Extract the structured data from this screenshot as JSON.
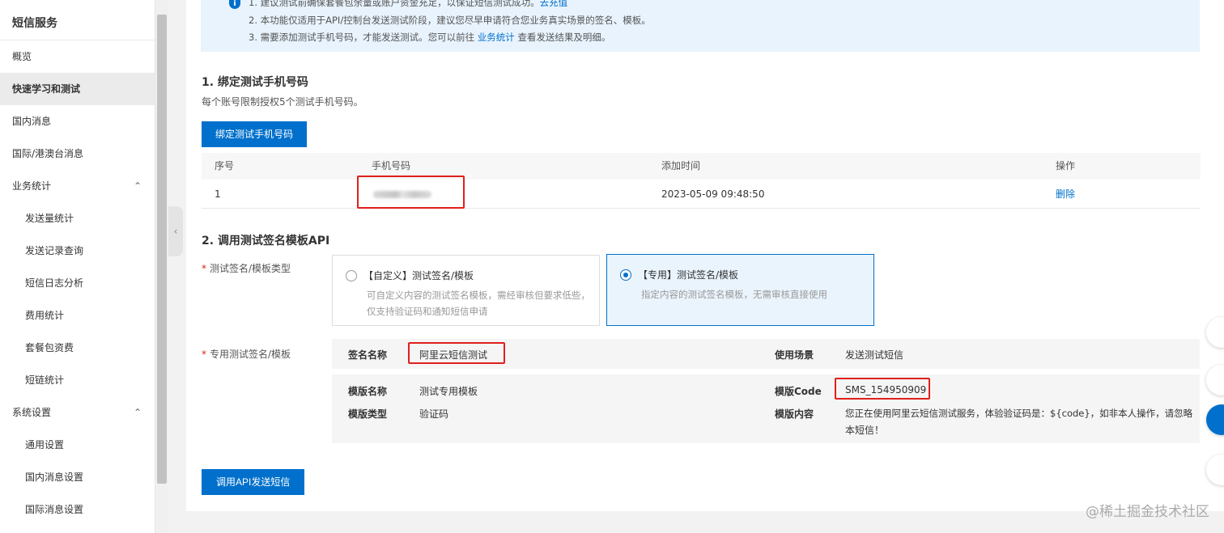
{
  "sidebar": {
    "title": "短信服务",
    "items": [
      {
        "label": "概览"
      },
      {
        "label": "快速学习和测试"
      },
      {
        "label": "国内消息"
      },
      {
        "label": "国际/港澳台消息"
      },
      {
        "label": "业务统计"
      },
      {
        "label": "发送量统计"
      },
      {
        "label": "发送记录查询"
      },
      {
        "label": "短信日志分析"
      },
      {
        "label": "费用统计"
      },
      {
        "label": "套餐包资费"
      },
      {
        "label": "短链统计"
      },
      {
        "label": "系统设置"
      },
      {
        "label": "通用设置"
      },
      {
        "label": "国内消息设置"
      },
      {
        "label": "国际消息设置"
      }
    ],
    "chevron": "⌃"
  },
  "notice": {
    "line1": "1. 建议测试前确保套餐包余量或账户资金充足，以保证短信测试成功。",
    "line1_link": "去充值",
    "line2": "2. 本功能仅适用于API/控制台发送测试阶段，建议您尽早申请符合您业务真实场景的签名、模板。",
    "line3_prefix": "3. 需要添加测试手机号码，才能发送测试。您可以前往",
    "line3_link": "业务统计",
    "line3_suffix": "查看发送结果及明细。"
  },
  "section1": {
    "title": "1. 绑定测试手机号码",
    "desc": "每个账号限制授权5个测试手机号码。",
    "button": "绑定测试手机号码",
    "table": {
      "headers": [
        "序号",
        "手机号码",
        "添加时间",
        "操作"
      ],
      "rows": [
        {
          "index": "1",
          "phone": "",
          "time": "2023-05-09 09:48:50",
          "action": "删除"
        }
      ]
    }
  },
  "section2": {
    "title": "2. 调用测试签名模板API",
    "type_label": "测试签名/模板类型",
    "option_custom_title": "【自定义】测试签名/模板",
    "option_custom_desc": "可自定义内容的测试签名模板，需经审核但要求低些，仅支持验证码和通知短信申请",
    "option_dedicated_title": "【专用】测试签名/模板",
    "option_dedicated_desc": "指定内容的测试签名模板，无需审核直接使用",
    "dedicated_label": "专用测试签名/模板",
    "sign_name_key": "签名名称",
    "sign_name_val": "阿里云短信测试",
    "scene_key": "使用场景",
    "scene_val": "发送测试短信",
    "tpl_name_key": "模版名称",
    "tpl_name_val": "测试专用模板",
    "tpl_code_key": "模版Code",
    "tpl_code_val": "SMS_154950909",
    "tpl_type_key": "模版类型",
    "tpl_type_val": "验证码",
    "tpl_content_key": "模版内容",
    "tpl_content_val1": "您正在使用阿里云短信测试服务，体验验证码是：${code}，如非本人操作，请忽略",
    "tpl_content_val2": "本短信！",
    "button": "调用API发送短信"
  },
  "watermark": "@稀土掘金技术社区",
  "colors": {
    "accent": "#0070cc",
    "highlight": "#e0201a"
  }
}
